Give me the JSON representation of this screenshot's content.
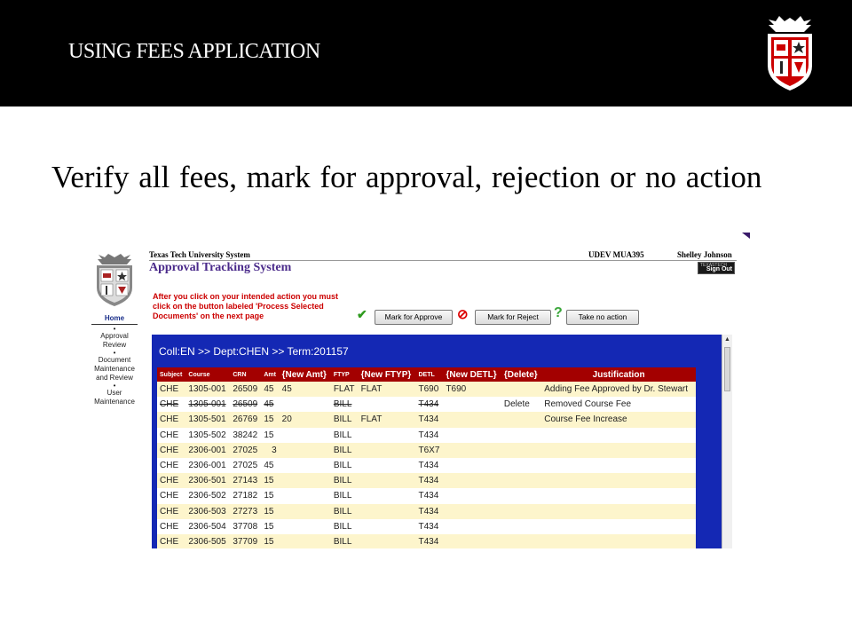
{
  "slide": {
    "title": "USING FEES APPLICATION",
    "subtitle": "Verify all fees, mark for approval, rejection or no action"
  },
  "app": {
    "org": "Texas Tech University System",
    "env": "UDEV   MUA395",
    "user": "Shelley Johnson",
    "title": "Approval Tracking System",
    "signout_small": "TEXASTECH",
    "signout": "Sign Out",
    "hint": "After you click on your intended action you must click on the button labeled 'Process Selected Documents' on the next page",
    "actions": {
      "approve": "Mark for Approve",
      "reject": "Mark for Reject",
      "noaction": "Take no action"
    },
    "nav": {
      "home": "Home",
      "approval": "Approval Review",
      "document": "Document Maintenance and Review",
      "user": "User Maintenance"
    },
    "breadcrumb": "Coll:EN >> Dept:CHEN >> Term:201157",
    "columns": [
      "Subject",
      "Course",
      "CRN",
      "Amt",
      "{New Amt}",
      "FTYP",
      "{New FTYP}",
      "DETL",
      "{New DETL}",
      "{Delete}",
      "Justification"
    ],
    "rows": [
      [
        "CHE",
        "1305-001",
        "26509",
        "45",
        "45",
        "FLAT",
        "FLAT",
        "T690",
        "T690",
        "",
        "Adding Fee Approved by Dr. Stewart"
      ],
      [
        "CHE",
        "1305-001",
        "26509",
        "45",
        "",
        "BILL",
        "",
        "T434",
        "",
        "Delete",
        "Removed Course Fee"
      ],
      [
        "CHE",
        "1305-501",
        "26769",
        "15",
        "20",
        "BILL",
        "FLAT",
        "T434",
        "",
        "",
        "Course Fee Increase"
      ],
      [
        "CHE",
        "1305-502",
        "38242",
        "15",
        "",
        "BILL",
        "",
        "T434",
        "",
        "",
        ""
      ],
      [
        "CHE",
        "2306-001",
        "27025",
        "3",
        "",
        "BILL",
        "",
        "T6X7",
        "",
        "",
        ""
      ],
      [
        "CHE",
        "2306-001",
        "27025",
        "45",
        "",
        "BILL",
        "",
        "T434",
        "",
        "",
        ""
      ],
      [
        "CHE",
        "2306-501",
        "27143",
        "15",
        "",
        "BILL",
        "",
        "T434",
        "",
        "",
        ""
      ],
      [
        "CHE",
        "2306-502",
        "27182",
        "15",
        "",
        "BILL",
        "",
        "T434",
        "",
        "",
        ""
      ],
      [
        "CHE",
        "2306-503",
        "27273",
        "15",
        "",
        "BILL",
        "",
        "T434",
        "",
        "",
        ""
      ],
      [
        "CHE",
        "2306-504",
        "37708",
        "15",
        "",
        "BILL",
        "",
        "T434",
        "",
        "",
        ""
      ],
      [
        "CHE",
        "2306-505",
        "37709",
        "15",
        "",
        "BILL",
        "",
        "T434",
        "",
        "",
        ""
      ]
    ]
  },
  "colors": {
    "brand_red": "#a30000",
    "panel_blue": "#1428b4",
    "row_alt": "#fdf5cc"
  }
}
